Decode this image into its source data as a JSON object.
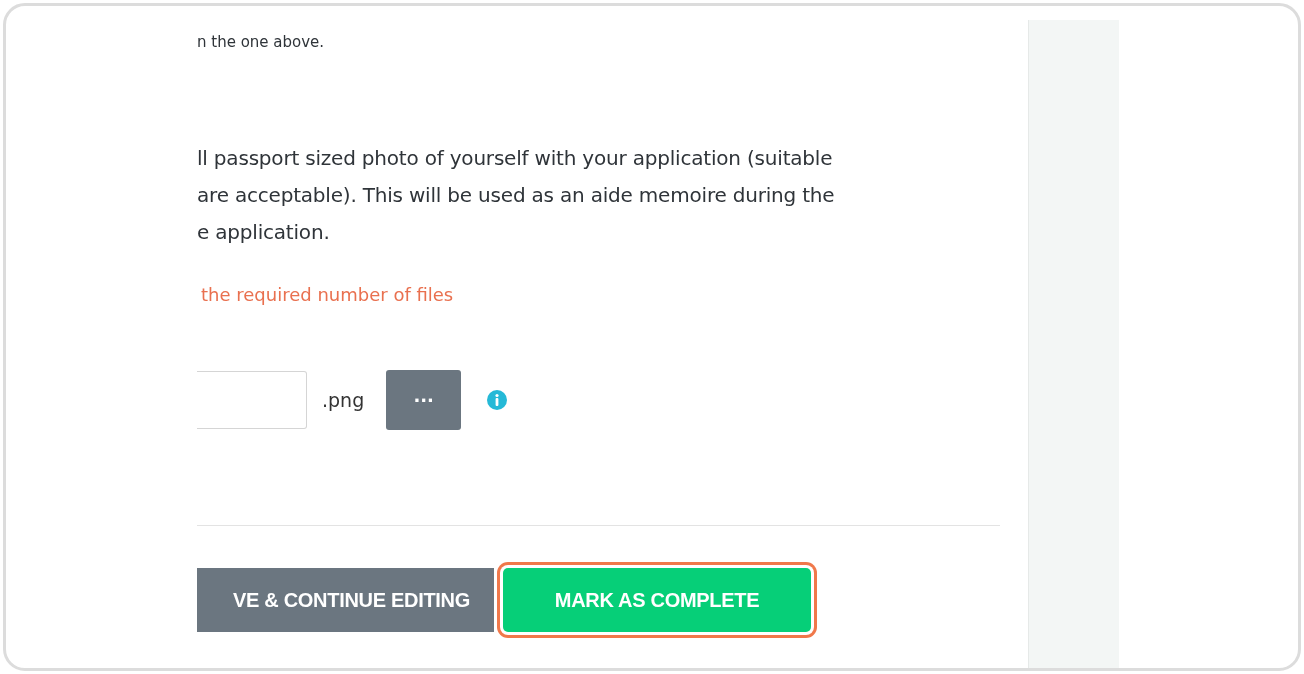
{
  "intro_text": "n the one above.",
  "photo_instructions": [
    "ll passport sized photo of yourself with your application (suitable",
    "are acceptable). This will be used as an aide memoire during the",
    "e application."
  ],
  "error_message": "the required number of files",
  "upload": {
    "extension": ".png",
    "browse_label": "···"
  },
  "buttons": [
    {
      "label": "VE & CONTINUE EDITING",
      "kind": "secondary",
      "highlighted": false
    },
    {
      "label": "MARK AS COMPLETE",
      "kind": "primary",
      "highlighted": true
    }
  ]
}
